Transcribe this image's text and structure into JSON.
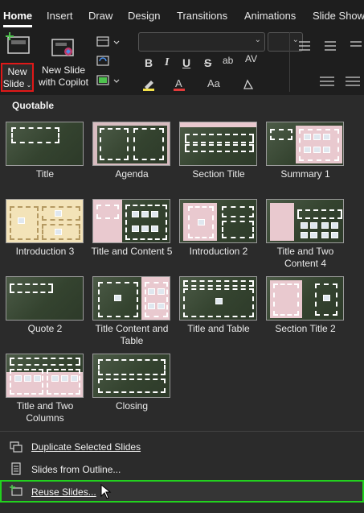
{
  "tabs": [
    "Home",
    "Insert",
    "Draw",
    "Design",
    "Transitions",
    "Animations",
    "Slide Show"
  ],
  "ribbon": {
    "new_slide_line1": "New",
    "new_slide_line2": "Slide",
    "copilot_line1": "New Slide",
    "copilot_line2": "with Copilot"
  },
  "gallery": {
    "section": "Quotable",
    "layouts": [
      {
        "label": "Title"
      },
      {
        "label": "Agenda"
      },
      {
        "label": "Section Title"
      },
      {
        "label": "Summary 1"
      },
      {
        "label": "Introduction 3"
      },
      {
        "label": "Title and Content 5"
      },
      {
        "label": "Introduction 2"
      },
      {
        "label": "Title and Two Content 4"
      },
      {
        "label": "Quote 2"
      },
      {
        "label": "Title Content and Table"
      },
      {
        "label": "Title and Table"
      },
      {
        "label": "Section Title 2"
      },
      {
        "label": "Title and Two Columns"
      },
      {
        "label": "Closing"
      }
    ]
  },
  "menu": {
    "duplicate": "Duplicate Selected Slides",
    "outline": "Slides from Outline...",
    "reuse": "Reuse Slides..."
  },
  "colors": {
    "highlight_red": "#e01818",
    "highlight_green": "#22d11e",
    "slide_bg": "#3b4a38",
    "accent_pink": "#e9c9cf"
  }
}
